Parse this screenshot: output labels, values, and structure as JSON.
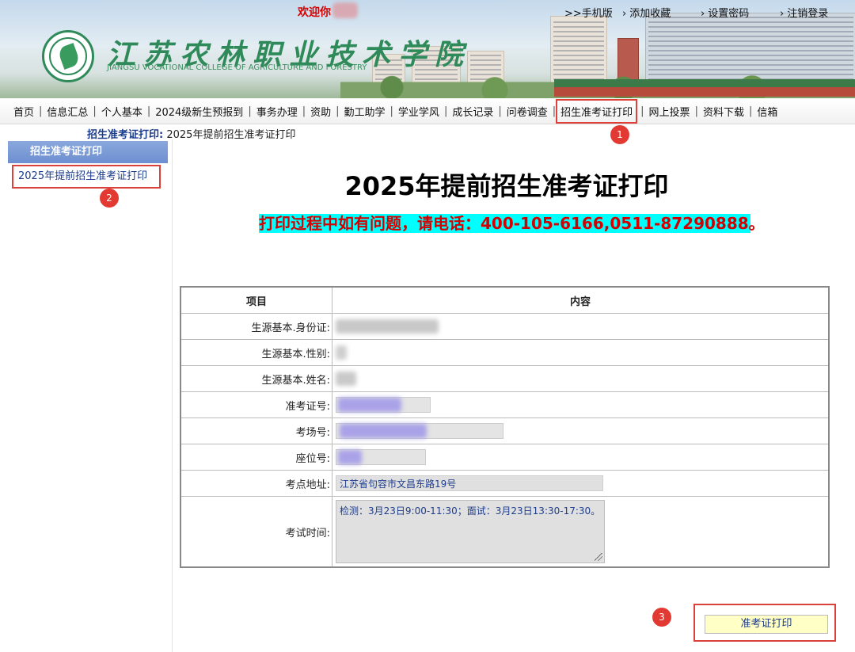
{
  "header": {
    "welcome": "欢迎你",
    "top_links": [
      ">>手机版",
      "添加收藏",
      "设置密码",
      "注销登录"
    ],
    "school_name_cn": "江苏农林职业技术学院",
    "school_name_en": "JIANGSU VOCATIONAL COLLEGE OF AGRICULTURE AND FORESTRY"
  },
  "nav": {
    "items": [
      "首页",
      "信息汇总",
      "个人基本",
      "2024级新生预报到",
      "事务办理",
      "资助",
      "勤工助学",
      "学业学风",
      "成长记录",
      "问卷调查",
      "招生准考证打印",
      "网上投票",
      "资料下载",
      "信箱"
    ],
    "active": "招生准考证打印"
  },
  "breadcrumb": {
    "section": "招生准考证打印",
    "page": "2025年提前招生准考证打印"
  },
  "sidebar": {
    "header": "招生准考证打印",
    "items": [
      "2025年提前招生准考证打印"
    ]
  },
  "main": {
    "title": "2025年提前招生准考证打印",
    "notice": "打印过程中如有问题，请电话：400-105-6166,0511-87290888。",
    "table": {
      "headers": [
        "项目",
        "内容"
      ],
      "rows": [
        {
          "label": "生源基本.身份证:",
          "value": ""
        },
        {
          "label": "生源基本.性别:",
          "value": ""
        },
        {
          "label": "生源基本.姓名:",
          "value": ""
        },
        {
          "label": "准考证号:",
          "value": ""
        },
        {
          "label": "考场号:",
          "value": ""
        },
        {
          "label": "座位号:",
          "value": ""
        },
        {
          "label": "考点地址:",
          "value": "江苏省句容市文昌东路19号"
        },
        {
          "label": "考试时间:",
          "value": "检测：3月23日9:00-11:30；面试：3月23日13:30-17:30。"
        }
      ]
    },
    "print_button": "准考证打印"
  },
  "annotations": {
    "badges": [
      "1",
      "2",
      "3"
    ]
  },
  "colors": {
    "accent_red": "#d40000",
    "notice_bg": "#00ffff",
    "sidebar_header": "#7b9bd8",
    "annotation": "#e23a32"
  }
}
